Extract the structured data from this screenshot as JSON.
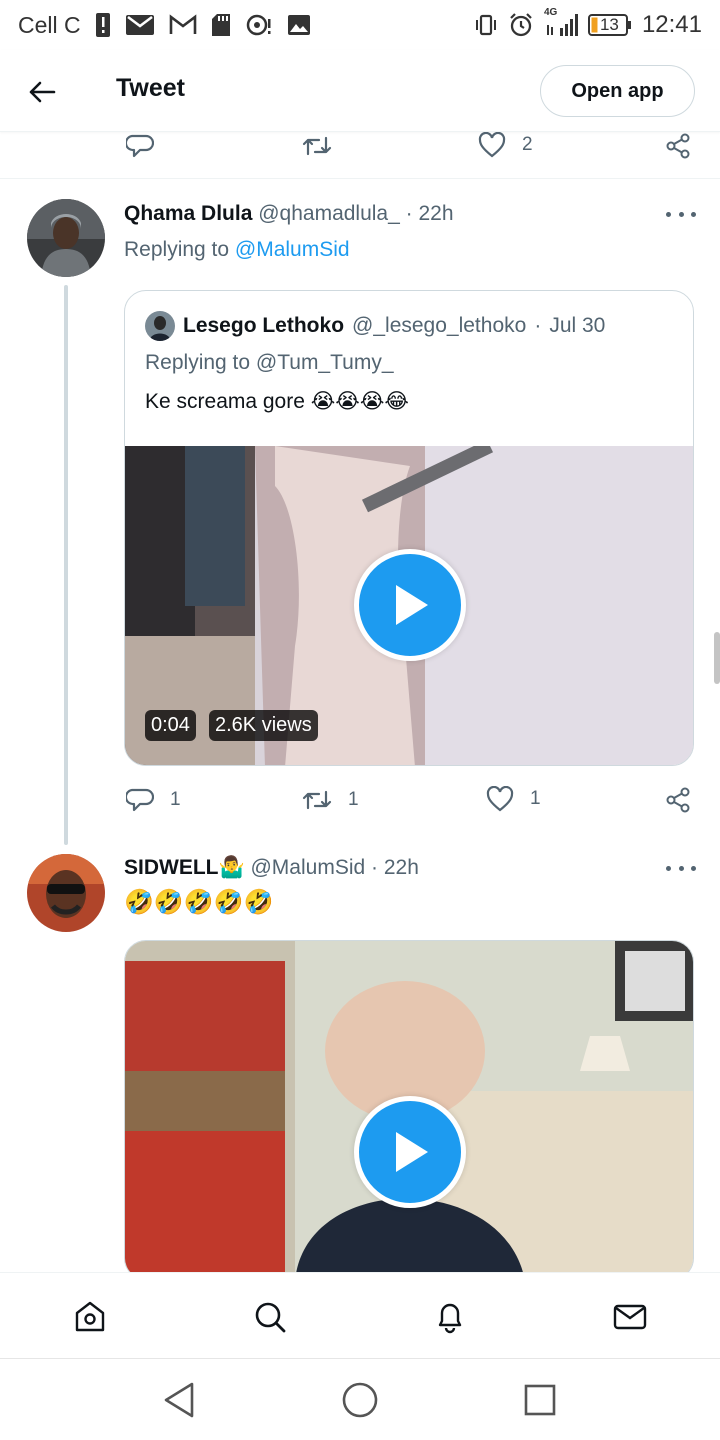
{
  "status_bar": {
    "carrier": "Cell C",
    "network": "4G",
    "battery": "13",
    "time": "12:41",
    "icons": [
      "alert-icon",
      "mail-icon",
      "gmail-icon",
      "sd-card-icon",
      "hotspot-icon",
      "image-icon",
      "vibrate-icon",
      "alarm-icon",
      "signal-icon",
      "battery-icon"
    ]
  },
  "header": {
    "title": "Tweet",
    "open_app_label": "Open app"
  },
  "top_actions": {
    "reply_count": "",
    "retweet_count": "",
    "like_count": "2"
  },
  "tweet1": {
    "name": "Qhama Dlula",
    "handle": "@qhamadlula_",
    "sep": "·",
    "time": "22h",
    "replying_prefix": "Replying to",
    "replying_handle": "@MalumSid",
    "quote": {
      "name": "Lesego Lethoko",
      "handle": "@_lesego_lethoko",
      "sep": "·",
      "date": "Jul 30",
      "replying": "Replying to @Tum_Tumy_",
      "text": "Ke screama gore 😭😭😭😂",
      "video_time": "0:04",
      "video_views": "2.6K views"
    },
    "actions": {
      "reply_count": "1",
      "retweet_count": "1",
      "like_count": "1"
    }
  },
  "tweet2": {
    "name": "SIDWELL🤷‍♂️",
    "handle": "@MalumSid",
    "sep": "·",
    "time": "22h",
    "text": "🤣🤣🤣🤣🤣"
  },
  "colors": {
    "accent": "#1d9bf0",
    "text": "#0f1419",
    "secondary": "#536471"
  }
}
